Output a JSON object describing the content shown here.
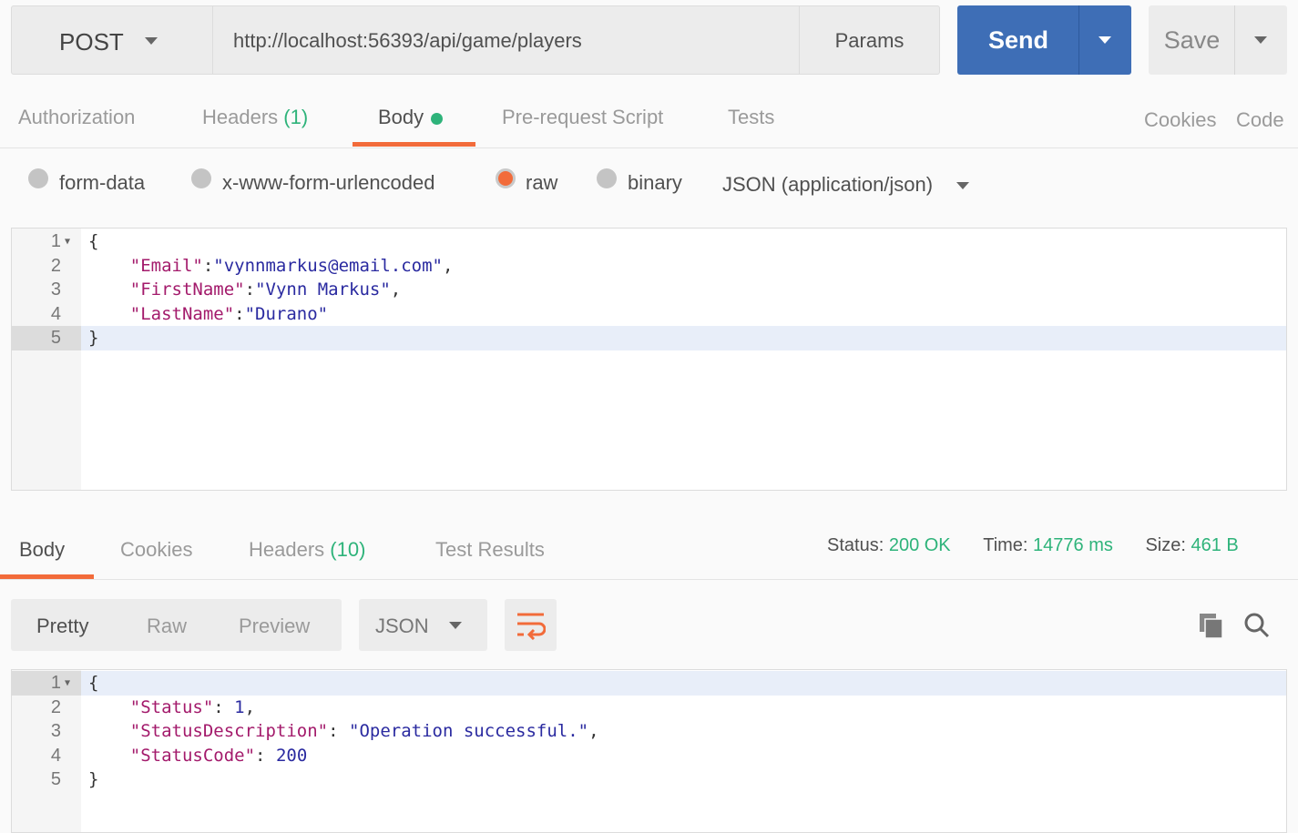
{
  "request": {
    "method": "POST",
    "url": "http://localhost:56393/api/game/players",
    "params_label": "Params",
    "send_label": "Send",
    "save_label": "Save"
  },
  "request_tabs": [
    {
      "label": "Authorization"
    },
    {
      "label": "Headers",
      "count": "(1)"
    },
    {
      "label": "Body",
      "active": true
    },
    {
      "label": "Pre-request Script"
    },
    {
      "label": "Tests"
    }
  ],
  "links": {
    "cookies": "Cookies",
    "code": "Code"
  },
  "body_modes": [
    {
      "label": "form-data"
    },
    {
      "label": "x-www-form-urlencoded"
    },
    {
      "label": "raw",
      "selected": true
    },
    {
      "label": "binary"
    }
  ],
  "content_type": "JSON (application/json)",
  "request_body": {
    "lines": [
      [
        {
          "t": "p",
          "v": "{"
        }
      ],
      [
        {
          "t": "p",
          "v": "    "
        },
        {
          "t": "k",
          "v": "\"Email\""
        },
        {
          "t": "p",
          "v": ":"
        },
        {
          "t": "s",
          "v": "\"vynnmarkus@email.com\""
        },
        {
          "t": "p",
          "v": ","
        }
      ],
      [
        {
          "t": "p",
          "v": "    "
        },
        {
          "t": "k",
          "v": "\"FirstName\""
        },
        {
          "t": "p",
          "v": ":"
        },
        {
          "t": "s",
          "v": "\"Vynn Markus\""
        },
        {
          "t": "p",
          "v": ","
        }
      ],
      [
        {
          "t": "p",
          "v": "    "
        },
        {
          "t": "k",
          "v": "\"LastName\""
        },
        {
          "t": "p",
          "v": ":"
        },
        {
          "t": "s",
          "v": "\"Durano\""
        }
      ],
      [
        {
          "t": "p",
          "v": "}"
        }
      ]
    ]
  },
  "response_tabs": [
    {
      "label": "Body",
      "active": true
    },
    {
      "label": "Cookies"
    },
    {
      "label": "Headers",
      "count": "(10)"
    },
    {
      "label": "Test Results"
    }
  ],
  "response_meta": {
    "status_label": "Status:",
    "status": "200 OK",
    "time_label": "Time:",
    "time": "14776 ms",
    "size_label": "Size:",
    "size": "461 B"
  },
  "view_modes": [
    "Pretty",
    "Raw",
    "Preview"
  ],
  "format": "JSON",
  "response_body": {
    "lines": [
      [
        {
          "t": "p",
          "v": "{"
        }
      ],
      [
        {
          "t": "p",
          "v": "    "
        },
        {
          "t": "k",
          "v": "\"Status\""
        },
        {
          "t": "p",
          "v": ": "
        },
        {
          "t": "n",
          "v": "1"
        },
        {
          "t": "p",
          "v": ","
        }
      ],
      [
        {
          "t": "p",
          "v": "    "
        },
        {
          "t": "k",
          "v": "\"StatusDescription\""
        },
        {
          "t": "p",
          "v": ": "
        },
        {
          "t": "s",
          "v": "\"Operation successful.\""
        },
        {
          "t": "p",
          "v": ","
        }
      ],
      [
        {
          "t": "p",
          "v": "    "
        },
        {
          "t": "k",
          "v": "\"StatusCode\""
        },
        {
          "t": "p",
          "v": ": "
        },
        {
          "t": "n",
          "v": "200"
        }
      ],
      [
        {
          "t": "p",
          "v": "}"
        }
      ]
    ]
  },
  "colors": {
    "accent": "#f26b3a",
    "send": "#3e6eb6",
    "success": "#2eb37a"
  }
}
